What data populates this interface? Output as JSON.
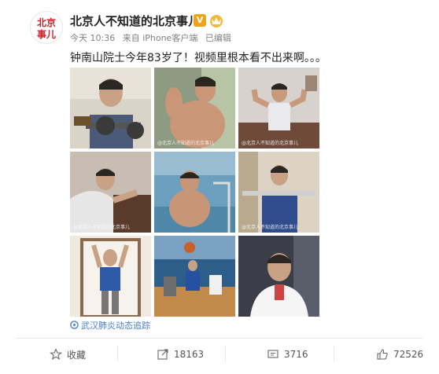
{
  "post": {
    "author": "北京人不知道的北京事儿",
    "avatar_text_top": "北京",
    "avatar_text_bottom": "事儿",
    "verified_badge": "V",
    "timestamp": "今天 10:36",
    "source": "来自 iPhone客户端",
    "edited": "已编辑",
    "text": "钟南山院士今年83岁了！视频里根本看不出来啊。。。",
    "photo_watermark": "@北京人不知道的北京事儿",
    "topic": "武汉肺炎动态追踪"
  },
  "actions": {
    "favorite_label": "收藏",
    "repost_count": "18163",
    "comment_count": "3716",
    "like_count": "72526"
  },
  "colors": {
    "accent_red": "#d0202a",
    "link_blue": "#4a7fc1",
    "verified_orange": "#f0a21a"
  }
}
